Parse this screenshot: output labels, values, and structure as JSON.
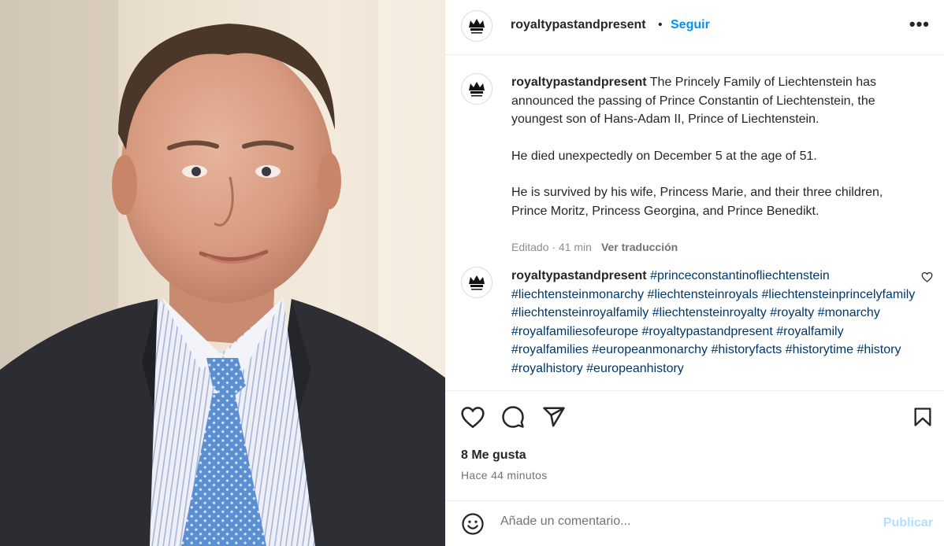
{
  "post": {
    "username": "royaltypastandpresent",
    "follow_label": "Seguir",
    "separator": "•",
    "more_label": "•••"
  },
  "caption": {
    "username": "royaltypastandpresent",
    "paragraphs": [
      "The Princely Family of Liechtenstein has announced the passing of Prince Constantin of Liechtenstein, the youngest son of Hans-Adam II, Prince of Liechtenstein.",
      "He died unexpectedly on December 5 at the age of 51.",
      "He is survived by his wife, Princess Marie, and their three children, Prince Moritz, Princess Georgina, and Prince Benedikt."
    ],
    "meta_text": "Editado · 41 min",
    "translate_label": "Ver traducción"
  },
  "hashtag_comment": {
    "username": "royaltypastandpresent",
    "hashtags": [
      "#princeconstantinofliechtenstein",
      "#liechtensteinmonarchy",
      "#liechtensteinroyals",
      "#liechtensteinprincelyfamily",
      "#liechtensteinroyalfamily",
      "#liechtensteinroyalty",
      "#royalty",
      "#monarchy",
      "#royalfamiliesofeurope",
      "#royaltypastandpresent",
      "#royalfamily",
      "#royalfamilies",
      "#europeanmonarchy",
      "#historyfacts",
      "#historytime",
      "#history",
      "#royalhistory",
      "#europeanhistory"
    ]
  },
  "footer": {
    "likes": "8 Me gusta",
    "time_ago": "Hace 44 minutos",
    "comment_placeholder": "Añade un comentario...",
    "post_label": "Publicar"
  },
  "icons": {
    "like": "heart-icon",
    "comment": "comment-bubble-icon",
    "share": "paper-plane-icon",
    "save": "bookmark-icon",
    "emoji": "emoji-icon",
    "comment_like": "small-heart-icon"
  },
  "colors": {
    "link_blue": "#0095f6",
    "hashtag": "#00376b",
    "post_disabled": "#b2dffc",
    "muted": "#737373"
  }
}
